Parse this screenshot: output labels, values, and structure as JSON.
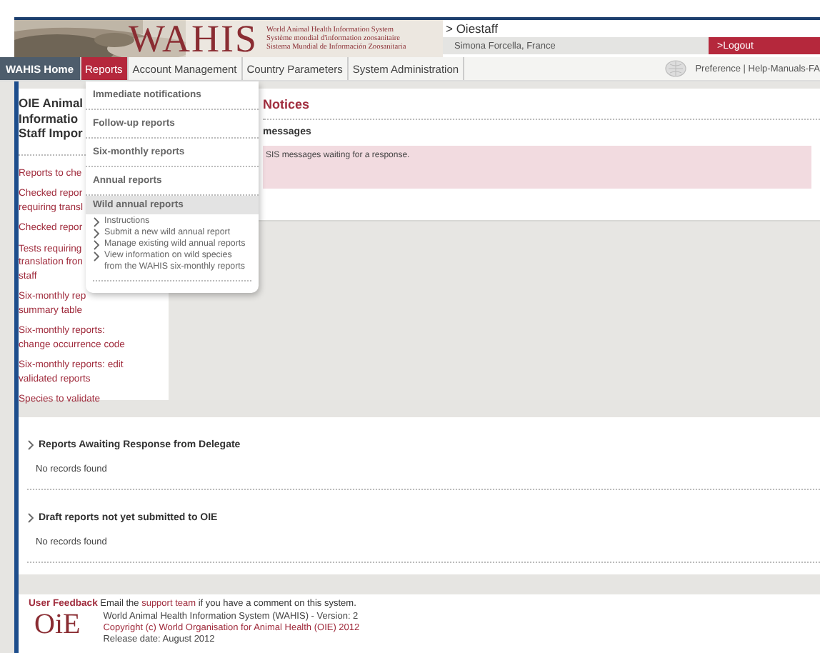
{
  "header": {
    "logo": "WAHIS",
    "system_names": [
      "World Animal Health Information System",
      "Système mondial d'information zoosanitaire",
      "Sistema Mundial de Información Zoosanitaria"
    ],
    "user": "> Oiestaff",
    "user_detail": "Simona Forcella, France",
    "logout": ">Logout"
  },
  "nav": {
    "tabs": [
      {
        "label": "WAHIS Home",
        "kind": "home",
        "selected": false
      },
      {
        "label": "Reports",
        "kind": "tab",
        "selected": true
      },
      {
        "label": "Account Management",
        "kind": "tab",
        "selected": false
      },
      {
        "label": "Country Parameters",
        "kind": "tab",
        "selected": false
      },
      {
        "label": "System Administration",
        "kind": "tab",
        "selected": false
      }
    ],
    "links": "Preference | Help-Manuals-FA"
  },
  "reports_menu": {
    "items": [
      {
        "label": "Immediate notifications",
        "expanded": false
      },
      {
        "label": "Follow-up reports",
        "expanded": false
      },
      {
        "label": "Six-monthly reports",
        "expanded": false
      },
      {
        "label": "Annual reports",
        "expanded": false
      },
      {
        "label": "Wild annual reports",
        "expanded": true,
        "children": [
          "Instructions",
          "Submit a new wild annual report",
          "Manage existing wild annual reports",
          "View information on wild species from the WAHIS six-monthly reports"
        ]
      }
    ]
  },
  "sidebar": {
    "title_lines": [
      "OIE Animal",
      "Informatio",
      "Staff Impor"
    ],
    "links": [
      [
        "Reports to che"
      ],
      [
        "Checked repor",
        "requiring transl"
      ],
      [
        "Checked repor"
      ],
      [
        "Tests requiring",
        "translation fron",
        "staff"
      ],
      [
        "Six-monthly rep",
        "summary table"
      ],
      [
        "Six-monthly reports:",
        "change occurrence code"
      ],
      [
        "Six-monthly reports: edit",
        "validated reports"
      ],
      [
        "Species to validate"
      ]
    ]
  },
  "notices": {
    "title": "Notices",
    "subtitle": "messages",
    "message": "SIS messages waiting for a response."
  },
  "sections": [
    {
      "title": "Reports Awaiting Response from Delegate",
      "body": "No records found"
    },
    {
      "title": "Draft reports not yet submitted to OIE",
      "body": "No records found"
    }
  ],
  "footer": {
    "feedback_label": "User Feedback",
    "feedback_before": "Email the ",
    "feedback_link": "support team",
    "feedback_after": " if you have a comment on this system.",
    "logo": "OiE",
    "lines": [
      {
        "text": "World Animal Health Information System (WAHIS) - Version: 2",
        "kind": "plain"
      },
      {
        "text": "Copyright (c) World Organisation for Animal Health (OIE) 2012",
        "kind": "link"
      },
      {
        "text": "Release date: August 2012",
        "kind": "plain"
      }
    ]
  }
}
